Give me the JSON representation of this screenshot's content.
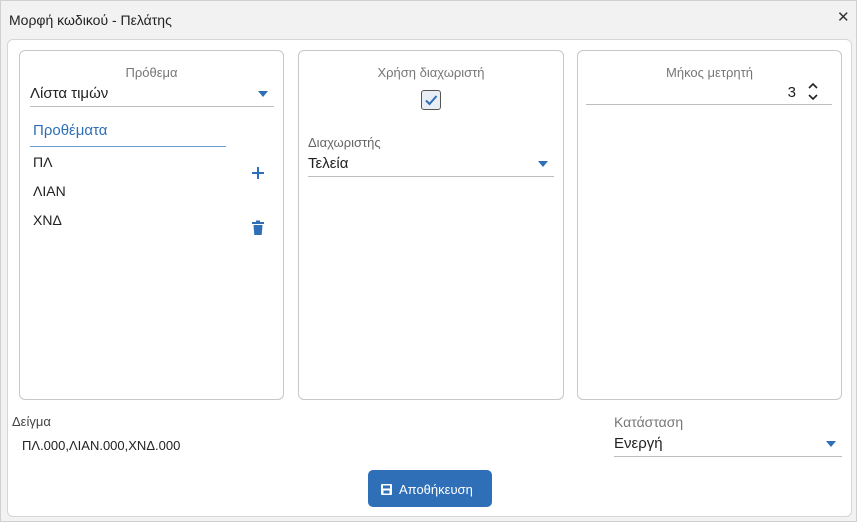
{
  "window": {
    "title": "Μορφή κωδικού - Πελάτης",
    "close_glyph": "✕"
  },
  "prefix_panel": {
    "title": "Πρόθεμα",
    "select_value": "Λίστα τιμών",
    "list_header": "Προθέματα",
    "items": [
      "ΠΛ",
      "ΛΙΑΝ",
      "ΧΝΔ"
    ],
    "add_icon": "plus-icon",
    "delete_icon": "trash-icon"
  },
  "separator_panel": {
    "title": "Χρήση διαχωριστή",
    "use_separator_checked": true,
    "separator_label": "Διαχωριστής",
    "separator_value": "Τελεία"
  },
  "counter_panel": {
    "title": "Μήκος μετρητή",
    "value": "3"
  },
  "sample": {
    "label": "Δείγμα",
    "value": "ΠΛ.000,ΛΙΑΝ.000,ΧΝΔ.000"
  },
  "status": {
    "label": "Κατάσταση",
    "value": "Ενεργή"
  },
  "save_button": {
    "label": "Αποθήκευση",
    "icon": "floppy-disk-icon"
  },
  "colors": {
    "accent": "#2f6fb7",
    "border": "#c8c8c8"
  }
}
